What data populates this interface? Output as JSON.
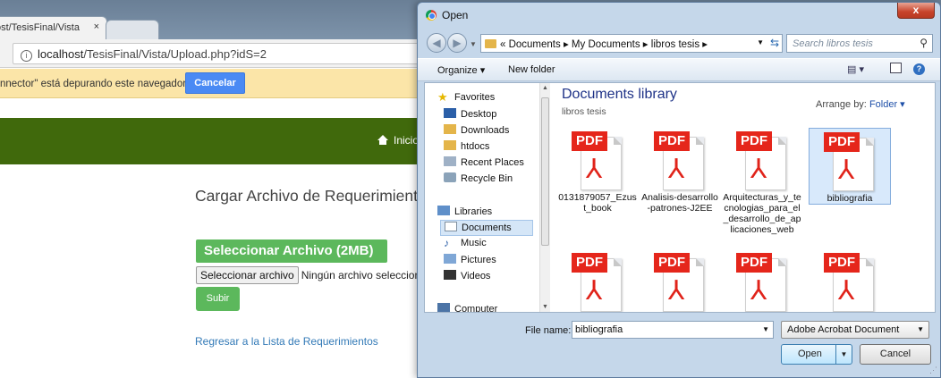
{
  "browser": {
    "tab_title": "ost/TesisFinal/Vista",
    "tab_close": "×",
    "address": {
      "host": "localhost",
      "path": "/TesisFinal/Vista/Upload.php?idS=2"
    },
    "debug_text": "nnector\" está depurando este navegador.",
    "cancel_label": "Cancelar"
  },
  "page": {
    "nav_home": "Inicio",
    "title": "Cargar Archivo de Requerimientos",
    "select_heading": "Seleccionar Archivo (2MB)",
    "file_button": "Seleccionar archivo",
    "file_status": "Ningún archivo seleccionado",
    "upload_button": "Subir",
    "back_link": "Regresar a la Lista de Requerimientos",
    "accent": "#40690c",
    "button_color": "#5cb85c"
  },
  "dialog": {
    "title": "Open",
    "close_glyph": "x",
    "breadcrumb": "« Documents ▸ My Documents ▸ libros tesis ▸",
    "search_placeholder": "Search libros tesis",
    "toolbar": {
      "organize": "Organize ▾",
      "new_folder": "New folder"
    },
    "nav_pane": {
      "favorites": "Favorites",
      "desktop": "Desktop",
      "downloads": "Downloads",
      "htdocs": "htdocs",
      "recent": "Recent Places",
      "recycle": "Recycle Bin",
      "libraries": "Libraries",
      "documents": "Documents",
      "music": "Music",
      "pictures": "Pictures",
      "videos": "Videos",
      "computer": "Computer"
    },
    "library_title": "Documents library",
    "library_sub": "libros tesis",
    "arrange_label": "Arrange by:",
    "arrange_value": "Folder ▾",
    "pdf_badge": "PDF",
    "files": [
      {
        "name": "0131879057_Ezust_book"
      },
      {
        "name": "Analisis-desarrollo-patrones-J2EE"
      },
      {
        "name": "Arquitecturas_y_tecnologias_para_el_desarrollo_de_aplicaciones_web"
      },
      {
        "name": "bibliografia"
      },
      {
        "name": ""
      },
      {
        "name": ""
      },
      {
        "name": ""
      },
      {
        "name": ""
      }
    ],
    "file_name_label": "File name:",
    "file_name_value": "bibliografia",
    "file_type": "Adobe Acrobat Document",
    "open_label": "Open",
    "cancel_label": "Cancel"
  }
}
